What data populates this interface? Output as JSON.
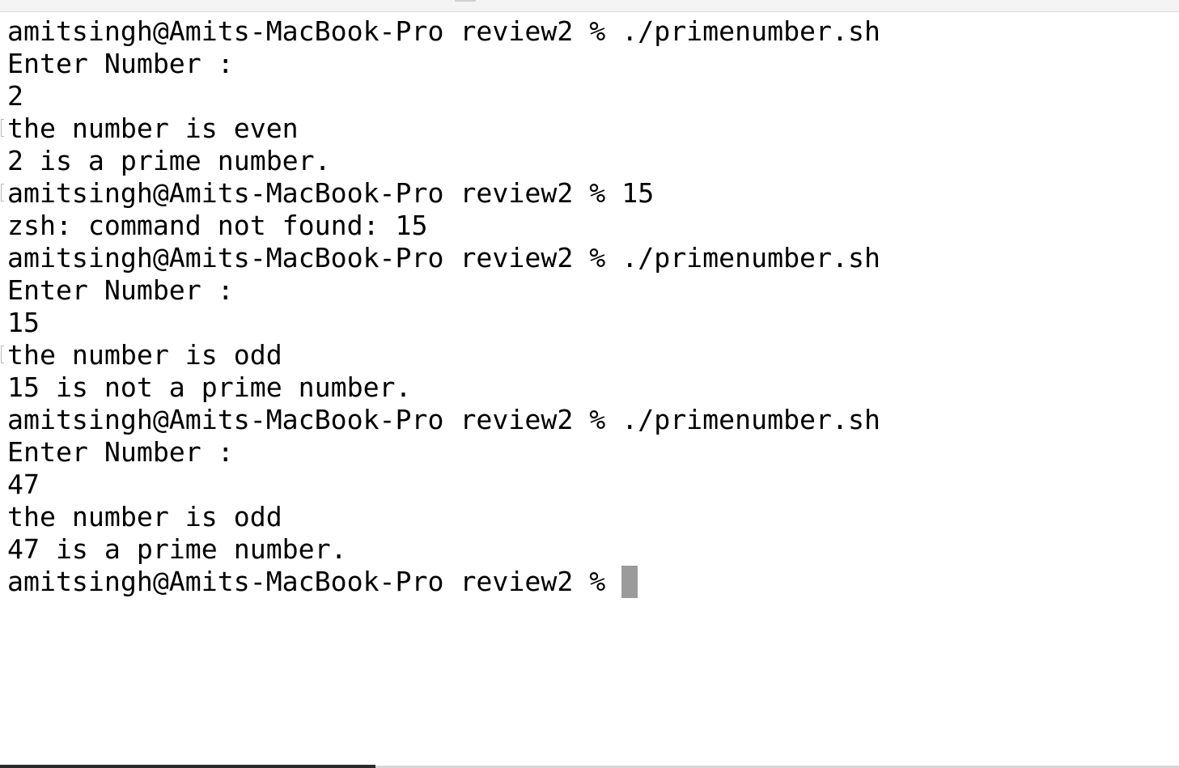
{
  "terminal": {
    "lines": [
      {
        "text": "amitsingh@Amits-MacBook-Pro review2 % ./primenumber.sh",
        "marked": false
      },
      {
        "text": "Enter Number :",
        "marked": false
      },
      {
        "text": "2",
        "marked": false
      },
      {
        "text": "the number is even",
        "marked": true
      },
      {
        "text": "2 is a prime number.",
        "marked": false
      },
      {
        "text": "amitsingh@Amits-MacBook-Pro review2 % 15",
        "marked": true
      },
      {
        "text": "zsh: command not found: 15",
        "marked": false
      },
      {
        "text": "amitsingh@Amits-MacBook-Pro review2 % ./primenumber.sh",
        "marked": false
      },
      {
        "text": "Enter Number :",
        "marked": false
      },
      {
        "text": "15",
        "marked": false
      },
      {
        "text": "the number is odd",
        "marked": true
      },
      {
        "text": "15 is not a prime number.",
        "marked": false
      },
      {
        "text": "amitsingh@Amits-MacBook-Pro review2 % ./primenumber.sh",
        "marked": false
      },
      {
        "text": "Enter Number :",
        "marked": false
      },
      {
        "text": "47",
        "marked": false
      },
      {
        "text": "the number is odd",
        "marked": false
      },
      {
        "text": "47 is a prime number.",
        "marked": false
      }
    ],
    "prompt": "amitsingh@Amits-MacBook-Pro review2 % ",
    "cursor_color": "#9b9b9b",
    "text_color": "#000000",
    "background_color": "#ffffff"
  }
}
